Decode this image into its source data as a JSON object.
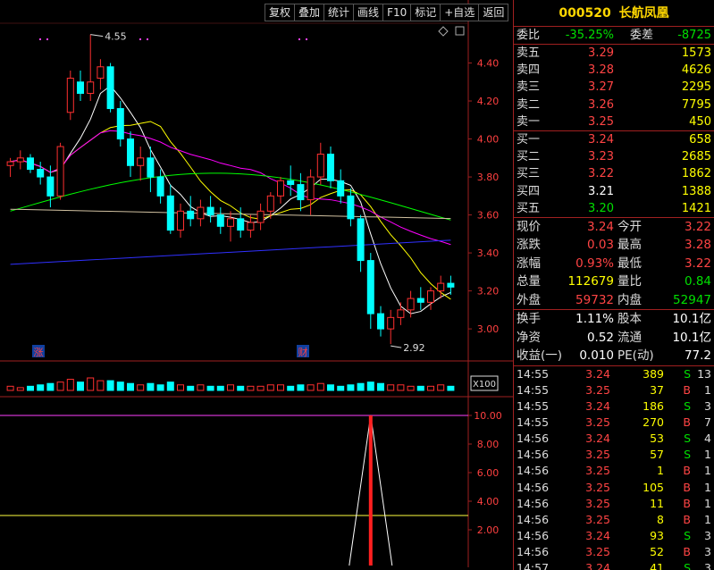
{
  "toolbar": [
    "复权",
    "叠加",
    "统计",
    "画线",
    "F10",
    "标记",
    "+自选",
    "返回"
  ],
  "chart": {
    "price_axis": [
      "4.40",
      "4.20",
      "4.00",
      "3.80",
      "3.60",
      "3.40",
      "3.20",
      "3.00"
    ],
    "high_marker": "4.55",
    "low_marker": "2.92",
    "event_zhang": "涨",
    "event_cai": "财",
    "volume_multiplier": "X100",
    "indicator_axis": [
      "10.00",
      "8.00",
      "6.00",
      "4.00",
      "2.00"
    ],
    "colors": {
      "up": "#ff3030",
      "down": "#00ffff",
      "ma5": "#ffffff",
      "ma10": "#ffff00",
      "ma20": "#ff00ff",
      "ma60": "#00ff00",
      "ma120": "#3030ff"
    }
  },
  "chart_data": {
    "type": "candlestick",
    "ylim": [
      2.85,
      4.6
    ],
    "candles": [
      [
        3.86,
        3.9,
        3.8,
        3.88
      ],
      [
        3.88,
        3.94,
        3.84,
        3.9
      ],
      [
        3.9,
        3.92,
        3.82,
        3.84
      ],
      [
        3.84,
        3.88,
        3.76,
        3.8
      ],
      [
        3.8,
        3.86,
        3.64,
        3.7
      ],
      [
        3.7,
        3.98,
        3.68,
        3.96
      ],
      [
        4.14,
        4.36,
        4.1,
        4.32
      ],
      [
        4.3,
        4.36,
        4.2,
        4.24
      ],
      [
        4.24,
        4.55,
        4.2,
        4.3
      ],
      [
        4.32,
        4.42,
        4.26,
        4.38
      ],
      [
        4.38,
        4.4,
        4.14,
        4.16
      ],
      [
        4.16,
        4.2,
        3.96,
        4.0
      ],
      [
        4.0,
        4.04,
        3.8,
        3.86
      ],
      [
        3.86,
        3.96,
        3.78,
        3.9
      ],
      [
        3.9,
        3.96,
        3.72,
        3.8
      ],
      [
        3.8,
        3.84,
        3.66,
        3.7
      ],
      [
        3.7,
        3.76,
        3.5,
        3.52
      ],
      [
        3.52,
        3.66,
        3.48,
        3.62
      ],
      [
        3.62,
        3.7,
        3.54,
        3.58
      ],
      [
        3.58,
        3.68,
        3.54,
        3.64
      ],
      [
        3.64,
        3.7,
        3.56,
        3.6
      ],
      [
        3.6,
        3.64,
        3.5,
        3.54
      ],
      [
        3.54,
        3.62,
        3.46,
        3.58
      ],
      [
        3.58,
        3.64,
        3.48,
        3.52
      ],
      [
        3.52,
        3.6,
        3.48,
        3.56
      ],
      [
        3.56,
        3.66,
        3.52,
        3.62
      ],
      [
        3.62,
        3.72,
        3.58,
        3.7
      ],
      [
        3.7,
        3.8,
        3.66,
        3.78
      ],
      [
        3.78,
        3.86,
        3.7,
        3.76
      ],
      [
        3.76,
        3.82,
        3.62,
        3.68
      ],
      [
        3.68,
        3.84,
        3.6,
        3.8
      ],
      [
        3.8,
        3.98,
        3.76,
        3.92
      ],
      [
        3.92,
        3.96,
        3.74,
        3.78
      ],
      [
        3.78,
        3.84,
        3.66,
        3.7
      ],
      [
        3.7,
        3.74,
        3.54,
        3.58
      ],
      [
        3.58,
        3.6,
        3.3,
        3.36
      ],
      [
        3.36,
        3.4,
        3.0,
        3.08
      ],
      [
        3.08,
        3.12,
        2.96,
        3.0
      ],
      [
        3.0,
        3.1,
        2.92,
        3.06
      ],
      [
        3.06,
        3.14,
        3.02,
        3.1
      ],
      [
        3.1,
        3.2,
        3.06,
        3.16
      ],
      [
        3.16,
        3.22,
        3.1,
        3.14
      ],
      [
        3.14,
        3.22,
        3.1,
        3.2
      ],
      [
        3.2,
        3.28,
        3.16,
        3.24
      ],
      [
        3.24,
        3.28,
        3.18,
        3.22
      ]
    ],
    "volume": [
      3,
      2,
      3,
      4,
      5,
      6,
      8,
      6,
      9,
      7,
      7,
      6,
      5,
      4,
      5,
      4,
      6,
      4,
      3,
      4,
      3,
      3,
      4,
      3,
      3,
      3,
      4,
      4,
      3,
      4,
      4,
      5,
      4,
      3,
      4,
      5,
      6,
      5,
      4,
      4,
      3,
      3,
      3,
      4,
      3
    ],
    "indicator": {
      "spike_index": 36,
      "spike_value": 10.0
    }
  },
  "quote": {
    "code": "000520",
    "name": "长航凤凰",
    "weibi_label": "委比",
    "weibi": "-35.25%",
    "weicha_label": "委差",
    "weicha": "-8725",
    "asks": [
      {
        "label": "卖五",
        "price": "3.29",
        "vol": "1573"
      },
      {
        "label": "卖四",
        "price": "3.28",
        "vol": "4626"
      },
      {
        "label": "卖三",
        "price": "3.27",
        "vol": "2295"
      },
      {
        "label": "卖二",
        "price": "3.26",
        "vol": "7795"
      },
      {
        "label": "卖一",
        "price": "3.25",
        "vol": "450"
      }
    ],
    "bids": [
      {
        "label": "买一",
        "price": "3.24",
        "vol": "658",
        "pc": "red"
      },
      {
        "label": "买二",
        "price": "3.23",
        "vol": "2685",
        "pc": "red"
      },
      {
        "label": "买三",
        "price": "3.22",
        "vol": "1862",
        "pc": "red"
      },
      {
        "label": "买四",
        "price": "3.21",
        "vol": "1388",
        "pc": "white"
      },
      {
        "label": "买五",
        "price": "3.20",
        "vol": "1421",
        "pc": "green"
      }
    ],
    "stats1": [
      {
        "l": "现价",
        "v": "3.24",
        "vc": "red",
        "l2": "今开",
        "v2": "3.22",
        "v2c": "red"
      },
      {
        "l": "涨跌",
        "v": "0.03",
        "vc": "red",
        "l2": "最高",
        "v2": "3.28",
        "v2c": "red"
      },
      {
        "l": "涨幅",
        "v": "0.93%",
        "vc": "red",
        "l2": "最低",
        "v2": "3.22",
        "v2c": "red"
      },
      {
        "l": "总量",
        "v": "112679",
        "vc": "yellow",
        "l2": "量比",
        "v2": "0.84",
        "v2c": "green"
      },
      {
        "l": "外盘",
        "v": "59732",
        "vc": "red",
        "l2": "内盘",
        "v2": "52947",
        "v2c": "green"
      }
    ],
    "stats2": [
      {
        "l": "换手",
        "v": "1.11%",
        "vc": "white",
        "l2": "股本",
        "v2": "10.1亿",
        "v2c": "white"
      },
      {
        "l": "净资",
        "v": "0.52",
        "vc": "white",
        "l2": "流通",
        "v2": "10.1亿",
        "v2c": "white"
      },
      {
        "l": "收益(一)",
        "v": "0.010",
        "vc": "white",
        "l2": "PE(动)",
        "v2": "77.2",
        "v2c": "white"
      }
    ],
    "ticks": [
      {
        "t": "14:55",
        "p": "3.24",
        "q": "389",
        "bs": "S",
        "n": "13"
      },
      {
        "t": "14:55",
        "p": "3.25",
        "q": "37",
        "bs": "B",
        "n": "1"
      },
      {
        "t": "14:55",
        "p": "3.24",
        "q": "186",
        "bs": "S",
        "n": "3"
      },
      {
        "t": "14:55",
        "p": "3.25",
        "q": "270",
        "bs": "B",
        "n": "7"
      },
      {
        "t": "14:56",
        "p": "3.24",
        "q": "53",
        "bs": "S",
        "n": "4"
      },
      {
        "t": "14:56",
        "p": "3.25",
        "q": "57",
        "bs": "S",
        "n": "1"
      },
      {
        "t": "14:56",
        "p": "3.25",
        "q": "1",
        "bs": "B",
        "n": "1"
      },
      {
        "t": "14:56",
        "p": "3.25",
        "q": "105",
        "bs": "B",
        "n": "1"
      },
      {
        "t": "14:56",
        "p": "3.25",
        "q": "11",
        "bs": "B",
        "n": "1"
      },
      {
        "t": "14:56",
        "p": "3.25",
        "q": "8",
        "bs": "B",
        "n": "1"
      },
      {
        "t": "14:56",
        "p": "3.24",
        "q": "93",
        "bs": "S",
        "n": "3"
      },
      {
        "t": "14:56",
        "p": "3.25",
        "q": "52",
        "bs": "B",
        "n": "3"
      },
      {
        "t": "14:57",
        "p": "3.24",
        "q": "41",
        "bs": "S",
        "n": "3"
      }
    ]
  }
}
